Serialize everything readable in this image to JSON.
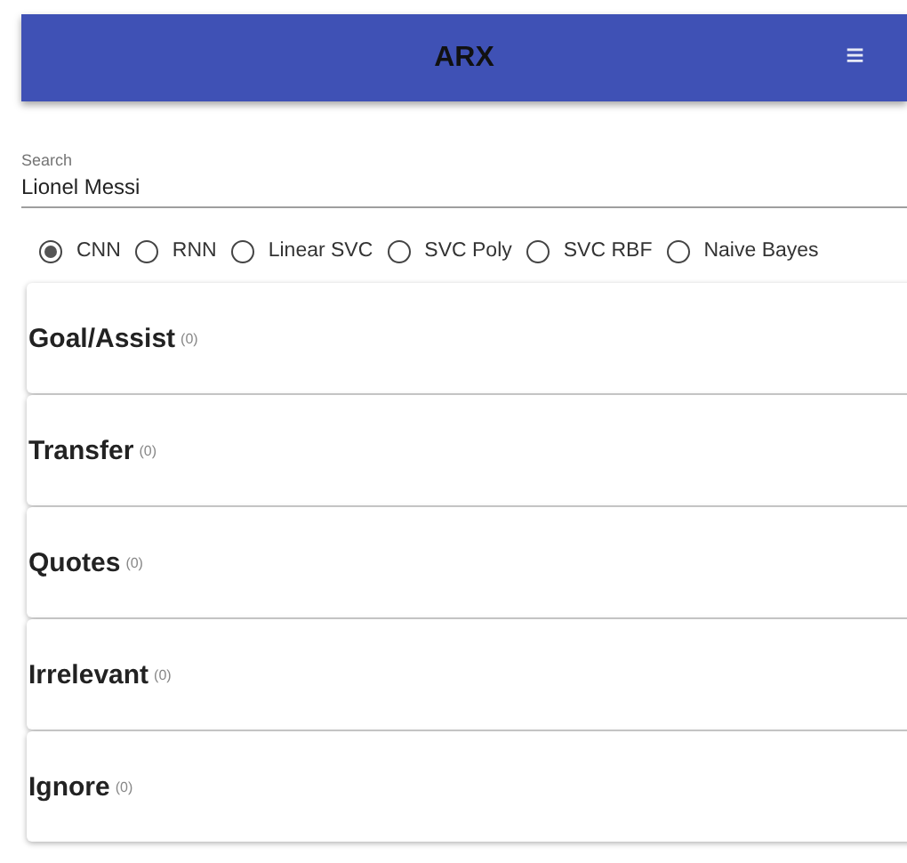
{
  "app_bar": {
    "title": "ARX",
    "menu_icon": "≡"
  },
  "search": {
    "label": "Search",
    "value": "Lionel Messi"
  },
  "models": [
    {
      "label": "CNN",
      "selected": true
    },
    {
      "label": "RNN",
      "selected": false
    },
    {
      "label": "Linear SVC",
      "selected": false
    },
    {
      "label": "SVC Poly",
      "selected": false
    },
    {
      "label": "SVC RBF",
      "selected": false
    },
    {
      "label": "Naive Bayes",
      "selected": false
    }
  ],
  "categories": [
    {
      "title": "Goal/Assist",
      "count": "(0)"
    },
    {
      "title": "Transfer",
      "count": "(0)"
    },
    {
      "title": "Quotes",
      "count": "(0)"
    },
    {
      "title": "Irrelevant",
      "count": "(0)"
    },
    {
      "title": "Ignore",
      "count": "(0)"
    }
  ]
}
